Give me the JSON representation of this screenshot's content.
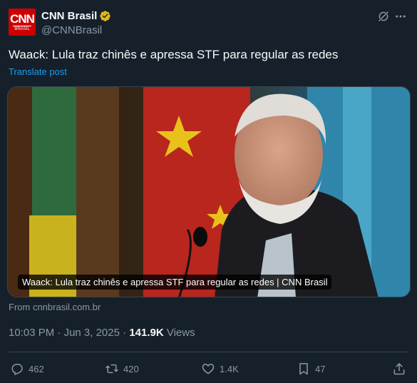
{
  "author": {
    "display_name": "CNN Brasil",
    "handle": "@CNNBrasil",
    "avatar_text_top": "CNN",
    "avatar_text_bottom": "BRASIL"
  },
  "post": {
    "text": "Waack: Lula traz chinês e apressa STF para regular as redes",
    "translate_label": "Translate post"
  },
  "card": {
    "caption": "Waack: Lula traz chinês e apressa STF para regular as redes | CNN Brasil",
    "source": "From cnnbrasil.com.br"
  },
  "meta": {
    "time": "10:03 PM",
    "separator1": " · ",
    "date": "Jun 3, 2025",
    "separator2": " · ",
    "views_count": "141.9K",
    "views_label": " Views"
  },
  "actions": {
    "replies": "462",
    "reposts": "420",
    "likes": "1.4K",
    "bookmarks": "47"
  },
  "colors": {
    "background": "#15202b",
    "accent": "#1d9bf0",
    "verified_gold": "#e2b719",
    "muted": "#8b98a5"
  },
  "icons": [
    "grok-icon",
    "more-icon",
    "verified-badge-icon",
    "reply-icon",
    "repost-icon",
    "like-icon",
    "bookmark-icon",
    "share-icon"
  ]
}
